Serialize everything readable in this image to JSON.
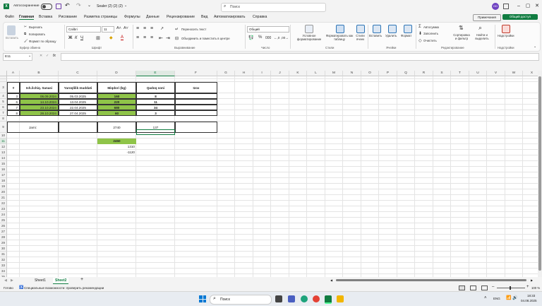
{
  "titlebar": {
    "autosave_label": "Автосохранение",
    "doc_title": "Sealer (2) (2) (2)",
    "search_placeholder": "Поиск",
    "avatar_initials": "GD"
  },
  "menu": [
    "Файл",
    "Главная",
    "Вставка",
    "Рисование",
    "Разметка страницы",
    "Формулы",
    "Данные",
    "Рецензирование",
    "Вид",
    "Автоматизировать",
    "Справка"
  ],
  "menu_right": {
    "comments": "Примечания",
    "share": "Общий доступ"
  },
  "ribbon": {
    "clipboard": {
      "paste": "Вставить",
      "cut": "Вырезать",
      "copy": "Копировать",
      "format_painter": "Формат по образцу",
      "label": "Буфер обмена"
    },
    "font": {
      "name": "Calibri",
      "size": "11",
      "label": "Шрифт"
    },
    "alignment": {
      "wrap": "Переносить текст",
      "merge": "Объединить и поместить в центре",
      "label": "Выравнивание"
    },
    "number": {
      "format": "Общий",
      "label": "Число"
    },
    "styles": {
      "conditional": "Условное форматирование",
      "as_table": "Форматировать как таблицу",
      "cell_styles": "Стили ячеек",
      "label": "Стили"
    },
    "cells": {
      "insert": "Вставить",
      "delete": "Удалить",
      "format": "Формат",
      "label": "Ячейки"
    },
    "editing": {
      "autosum": "Автосумма",
      "fill": "Заполнить",
      "clear": "Очистить",
      "sort": "Сортировка и фильтр",
      "find": "Найти и выделить",
      "label": "Редактирование"
    },
    "addins": {
      "addins": "Надстройки",
      "label": "Надстройки"
    }
  },
  "formula_bar": {
    "namebox": "E11",
    "fx": "fx",
    "content": ""
  },
  "columns": [
    "A",
    "B",
    "C",
    "D",
    "E",
    "F",
    "G",
    "H",
    "I",
    "J",
    "K",
    "L",
    "M",
    "N",
    "O",
    "P",
    "Q",
    "R",
    "S",
    "T",
    "U",
    "V",
    "W",
    "X"
  ],
  "rows": [
    "1",
    "2",
    "3",
    "4",
    "5",
    "6",
    "7",
    "8",
    "9",
    "10",
    "11",
    "12",
    "13",
    "14",
    "15",
    "16",
    "17",
    "18",
    "19",
    "20",
    "21",
    "22",
    "23",
    "24",
    "25",
    "26",
    "27",
    "28",
    "29",
    "30",
    "31",
    "32",
    "33",
    "34",
    "35",
    "36"
  ],
  "table": {
    "headers": [
      "#",
      "Ish./ichiq. Sanasi",
      "Yaroqlilik muddati",
      "Miqdori (kg)",
      "Qadoq soni",
      "Izox"
    ],
    "rows": [
      [
        "3",
        "06.09.2024",
        "05.03.2025",
        "160",
        "8",
        ""
      ],
      [
        "6",
        "14.10.2024",
        "13.04.2025",
        "220",
        "11",
        ""
      ],
      [
        "7",
        "23.10.2024",
        "22.04.2025",
        "680",
        "34",
        ""
      ],
      [
        "8",
        "28.10.2024",
        "27.04.2025",
        "60",
        "3",
        ""
      ]
    ],
    "total_label": "Jami:",
    "total_kg": "2740",
    "total_count": "137"
  },
  "extra": {
    "d12": "2450",
    "d13": "1310",
    "d14": "-1120"
  },
  "sheets": [
    "Sheet1",
    "Sheet2"
  ],
  "status": {
    "ready": "Готово",
    "accessibility": "Специальные возможности: проверить рекомендации",
    "zoom": "100 %"
  },
  "taskbar": {
    "search": "Поиск",
    "lang": "ENG",
    "time": "18:33",
    "date": "04.08.2025"
  }
}
